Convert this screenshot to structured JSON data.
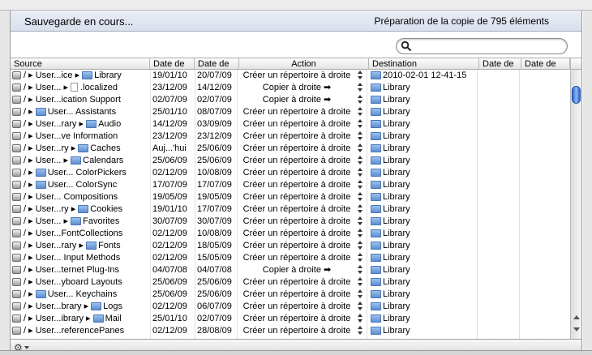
{
  "status": {
    "left": "Sauvegarde en cours...",
    "right": "Préparation de la copie de 795 éléments"
  },
  "search": {
    "value": "",
    "placeholder": ""
  },
  "columns": {
    "source": "Source",
    "date1": "Date de",
    "date2": "Date de",
    "action": "Action",
    "destination": "Destination",
    "date3": "Date de",
    "date4": "Date de"
  },
  "rows": [
    {
      "src": "/ ▸ User...ice ▸ Library",
      "ico": "folder",
      "d1": "19/01/10",
      "d2": "20/07/09",
      "action": "Créer un répertoire à droite",
      "dest": "2010-02-01 12-41-15"
    },
    {
      "src": "/ ▸ User... ▸ .localized",
      "ico": "file",
      "d1": "23/12/09",
      "d2": "14/12/09",
      "action": "Copier à droite ➡",
      "dest": "Library"
    },
    {
      "src": "/ ▸ User...ication Support",
      "ico": "none",
      "d1": "02/07/09",
      "d2": "02/07/09",
      "action": "Copier à droite ➡",
      "dest": "Library"
    },
    {
      "src": "/ ▸ User... Assistants",
      "ico": "folder",
      "d1": "25/01/10",
      "d2": "08/07/09",
      "action": "Créer un répertoire à droite",
      "dest": "Library"
    },
    {
      "src": "/ ▸ User...rary ▸ Audio",
      "ico": "folder",
      "d1": "14/12/09",
      "d2": "03/09/09",
      "action": "Créer un répertoire à droite",
      "dest": "Library"
    },
    {
      "src": "/ ▸ User...ve Information",
      "ico": "none",
      "d1": "23/12/09",
      "d2": "23/12/09",
      "action": "Créer un répertoire à droite",
      "dest": "Library"
    },
    {
      "src": "/ ▸ User...ry ▸ Caches",
      "ico": "folder",
      "d1": "Auj...'hui",
      "d2": "25/06/09",
      "action": "Créer un répertoire à droite",
      "dest": "Library"
    },
    {
      "src": "/ ▸ User... ▸ Calendars",
      "ico": "folder",
      "d1": "25/06/09",
      "d2": "25/06/09",
      "action": "Créer un répertoire à droite",
      "dest": "Library"
    },
    {
      "src": "/ ▸ User... ColorPickers",
      "ico": "folder",
      "d1": "02/12/09",
      "d2": "10/08/09",
      "action": "Créer un répertoire à droite",
      "dest": "Library"
    },
    {
      "src": "/ ▸ User... ColorSync",
      "ico": "folder",
      "d1": "17/07/09",
      "d2": "17/07/09",
      "action": "Créer un répertoire à droite",
      "dest": "Library"
    },
    {
      "src": "/ ▸ User... Compositions",
      "ico": "none",
      "d1": "19/05/09",
      "d2": "19/05/09",
      "action": "Créer un répertoire à droite",
      "dest": "Library"
    },
    {
      "src": "/ ▸ User...ry ▸ Cookies",
      "ico": "folder",
      "d1": "19/01/10",
      "d2": "17/07/09",
      "action": "Créer un répertoire à droite",
      "dest": "Library"
    },
    {
      "src": "/ ▸ User... ▸ Favorites",
      "ico": "folder",
      "d1": "30/07/09",
      "d2": "30/07/09",
      "action": "Créer un répertoire à droite",
      "dest": "Library"
    },
    {
      "src": "/ ▸ User...FontCollections",
      "ico": "none",
      "d1": "02/12/09",
      "d2": "10/08/09",
      "action": "Créer un répertoire à droite",
      "dest": "Library"
    },
    {
      "src": "/ ▸ User...rary ▸ Fonts",
      "ico": "folder",
      "d1": "02/12/09",
      "d2": "18/05/09",
      "action": "Créer un répertoire à droite",
      "dest": "Library"
    },
    {
      "src": "/ ▸ User... Input Methods",
      "ico": "none",
      "d1": "02/12/09",
      "d2": "15/05/09",
      "action": "Créer un répertoire à droite",
      "dest": "Library"
    },
    {
      "src": "/ ▸ User...ternet Plug-Ins",
      "ico": "none",
      "d1": "04/07/08",
      "d2": "04/07/08",
      "action": "Copier à droite ➡",
      "dest": "Library"
    },
    {
      "src": "/ ▸ User...yboard Layouts",
      "ico": "none",
      "d1": "25/06/09",
      "d2": "25/06/09",
      "action": "Créer un répertoire à droite",
      "dest": "Library"
    },
    {
      "src": "/ ▸ User... Keychains",
      "ico": "folder",
      "d1": "25/06/09",
      "d2": "25/06/09",
      "action": "Créer un répertoire à droite",
      "dest": "Library"
    },
    {
      "src": "/ ▸ User...brary ▸ Logs",
      "ico": "folder",
      "d1": "02/12/09",
      "d2": "06/07/09",
      "action": "Créer un répertoire à droite",
      "dest": "Library"
    },
    {
      "src": "/ ▸ User...ibrary ▸ Mail",
      "ico": "folder",
      "d1": "25/01/10",
      "d2": "02/07/09",
      "action": "Créer un répertoire à droite",
      "dest": "Library"
    },
    {
      "src": "/ ▸ User...referencePanes",
      "ico": "none",
      "d1": "02/12/09",
      "d2": "28/08/09",
      "action": "Créer un répertoire à droite",
      "dest": "Library"
    }
  ],
  "icons": {
    "search": "magnifier-icon",
    "gear": "gear-icon",
    "disk": "disk-icon",
    "folder": "folder-icon"
  }
}
